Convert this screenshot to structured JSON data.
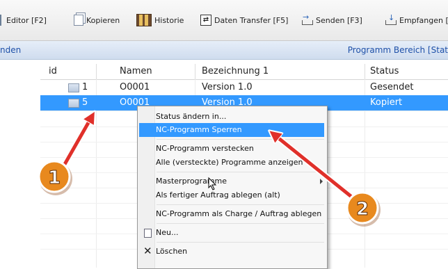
{
  "toolbar": {
    "editor_label": "Editor [F2]",
    "copy_label": "Kopieren",
    "history_label": "Historie",
    "transfer_label": "Daten Transfer [F5]",
    "send_label": "Senden [F3]",
    "receive_label": "Empfangen [F"
  },
  "strip": {
    "left_text": "nden",
    "right_text": "Programm Bereich [Stat"
  },
  "table": {
    "columns": [
      "id",
      "Namen",
      "Bezeichnung 1",
      "Status"
    ],
    "rows": [
      {
        "id": "1",
        "name": "O0001",
        "designation": "Version 1.0",
        "status": "Gesendet",
        "selected": false
      },
      {
        "id": "5",
        "name": "O0001",
        "designation": "Version 1.0",
        "status": "Kopiert",
        "selected": true
      }
    ]
  },
  "context_menu": {
    "items": [
      {
        "label": "Status ändern in...",
        "highlighted": false
      },
      {
        "label": "NC-Programm Sperren",
        "highlighted": true
      },
      {
        "label": "NC-Programm verstecken",
        "highlighted": false
      },
      {
        "label": "Alle (versteckte) Programme anzeigen",
        "highlighted": false
      },
      {
        "label": "Masterprogramme",
        "highlighted": false,
        "has_submenu": true
      },
      {
        "label": "Als fertiger Auftrag ablegen (alt)",
        "highlighted": false
      },
      {
        "label": "NC-Programm als Charge / Auftrag ablegen",
        "highlighted": false
      },
      {
        "label": "Neu...",
        "highlighted": false,
        "icon": "new-document-icon"
      },
      {
        "label": "Löschen",
        "highlighted": false,
        "icon": "delete-x-icon"
      }
    ]
  },
  "annotations": {
    "badge_1": "1",
    "badge_2": "2",
    "badge_color": "#e8891e",
    "arrow_color": "#e0302a"
  },
  "colors": {
    "selection": "#3399ff",
    "link_blue": "#1e50a8"
  }
}
